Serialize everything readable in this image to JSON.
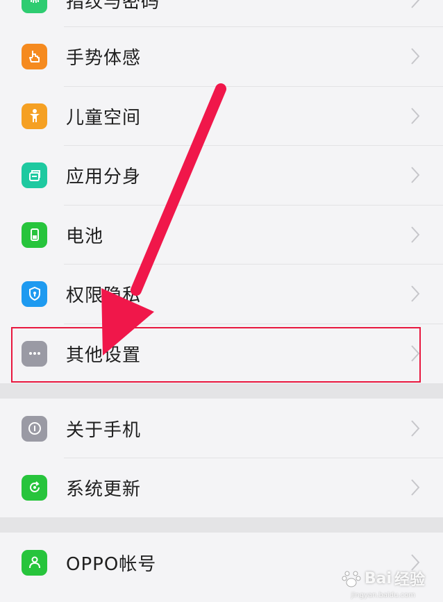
{
  "settings_list": {
    "rows": [
      {
        "label": "指纹与密码",
        "icon": "fingerprint-icon",
        "color": "#2ecc71"
      },
      {
        "label": "手势体感",
        "icon": "hand-gesture-icon",
        "color": "#f58a1f"
      },
      {
        "label": "儿童空间",
        "icon": "child-icon",
        "color": "#f5a023"
      },
      {
        "label": "应用分身",
        "icon": "app-clone-icon",
        "color": "#1ec9a0"
      },
      {
        "label": "电池",
        "icon": "battery-icon",
        "color": "#27c43c"
      },
      {
        "label": "权限隐私",
        "icon": "shield-icon",
        "color": "#1e9af0"
      },
      {
        "label": "其他设置",
        "icon": "more-dots-icon",
        "color": "#9a9aa4"
      },
      {
        "label": "关于手机",
        "icon": "info-icon",
        "color": "#9a9aa4"
      },
      {
        "label": "系统更新",
        "icon": "update-icon",
        "color": "#27c43c"
      },
      {
        "label": "OPPO帐号",
        "icon": "account-icon",
        "color": "#27c43c"
      }
    ]
  },
  "annotation": {
    "highlight_color": "#e8173e",
    "arrow_color": "#f0174a"
  },
  "watermark": {
    "brand": "Bai",
    "brand_suffix": "经验",
    "domain": "jingyan.baidu.com"
  }
}
